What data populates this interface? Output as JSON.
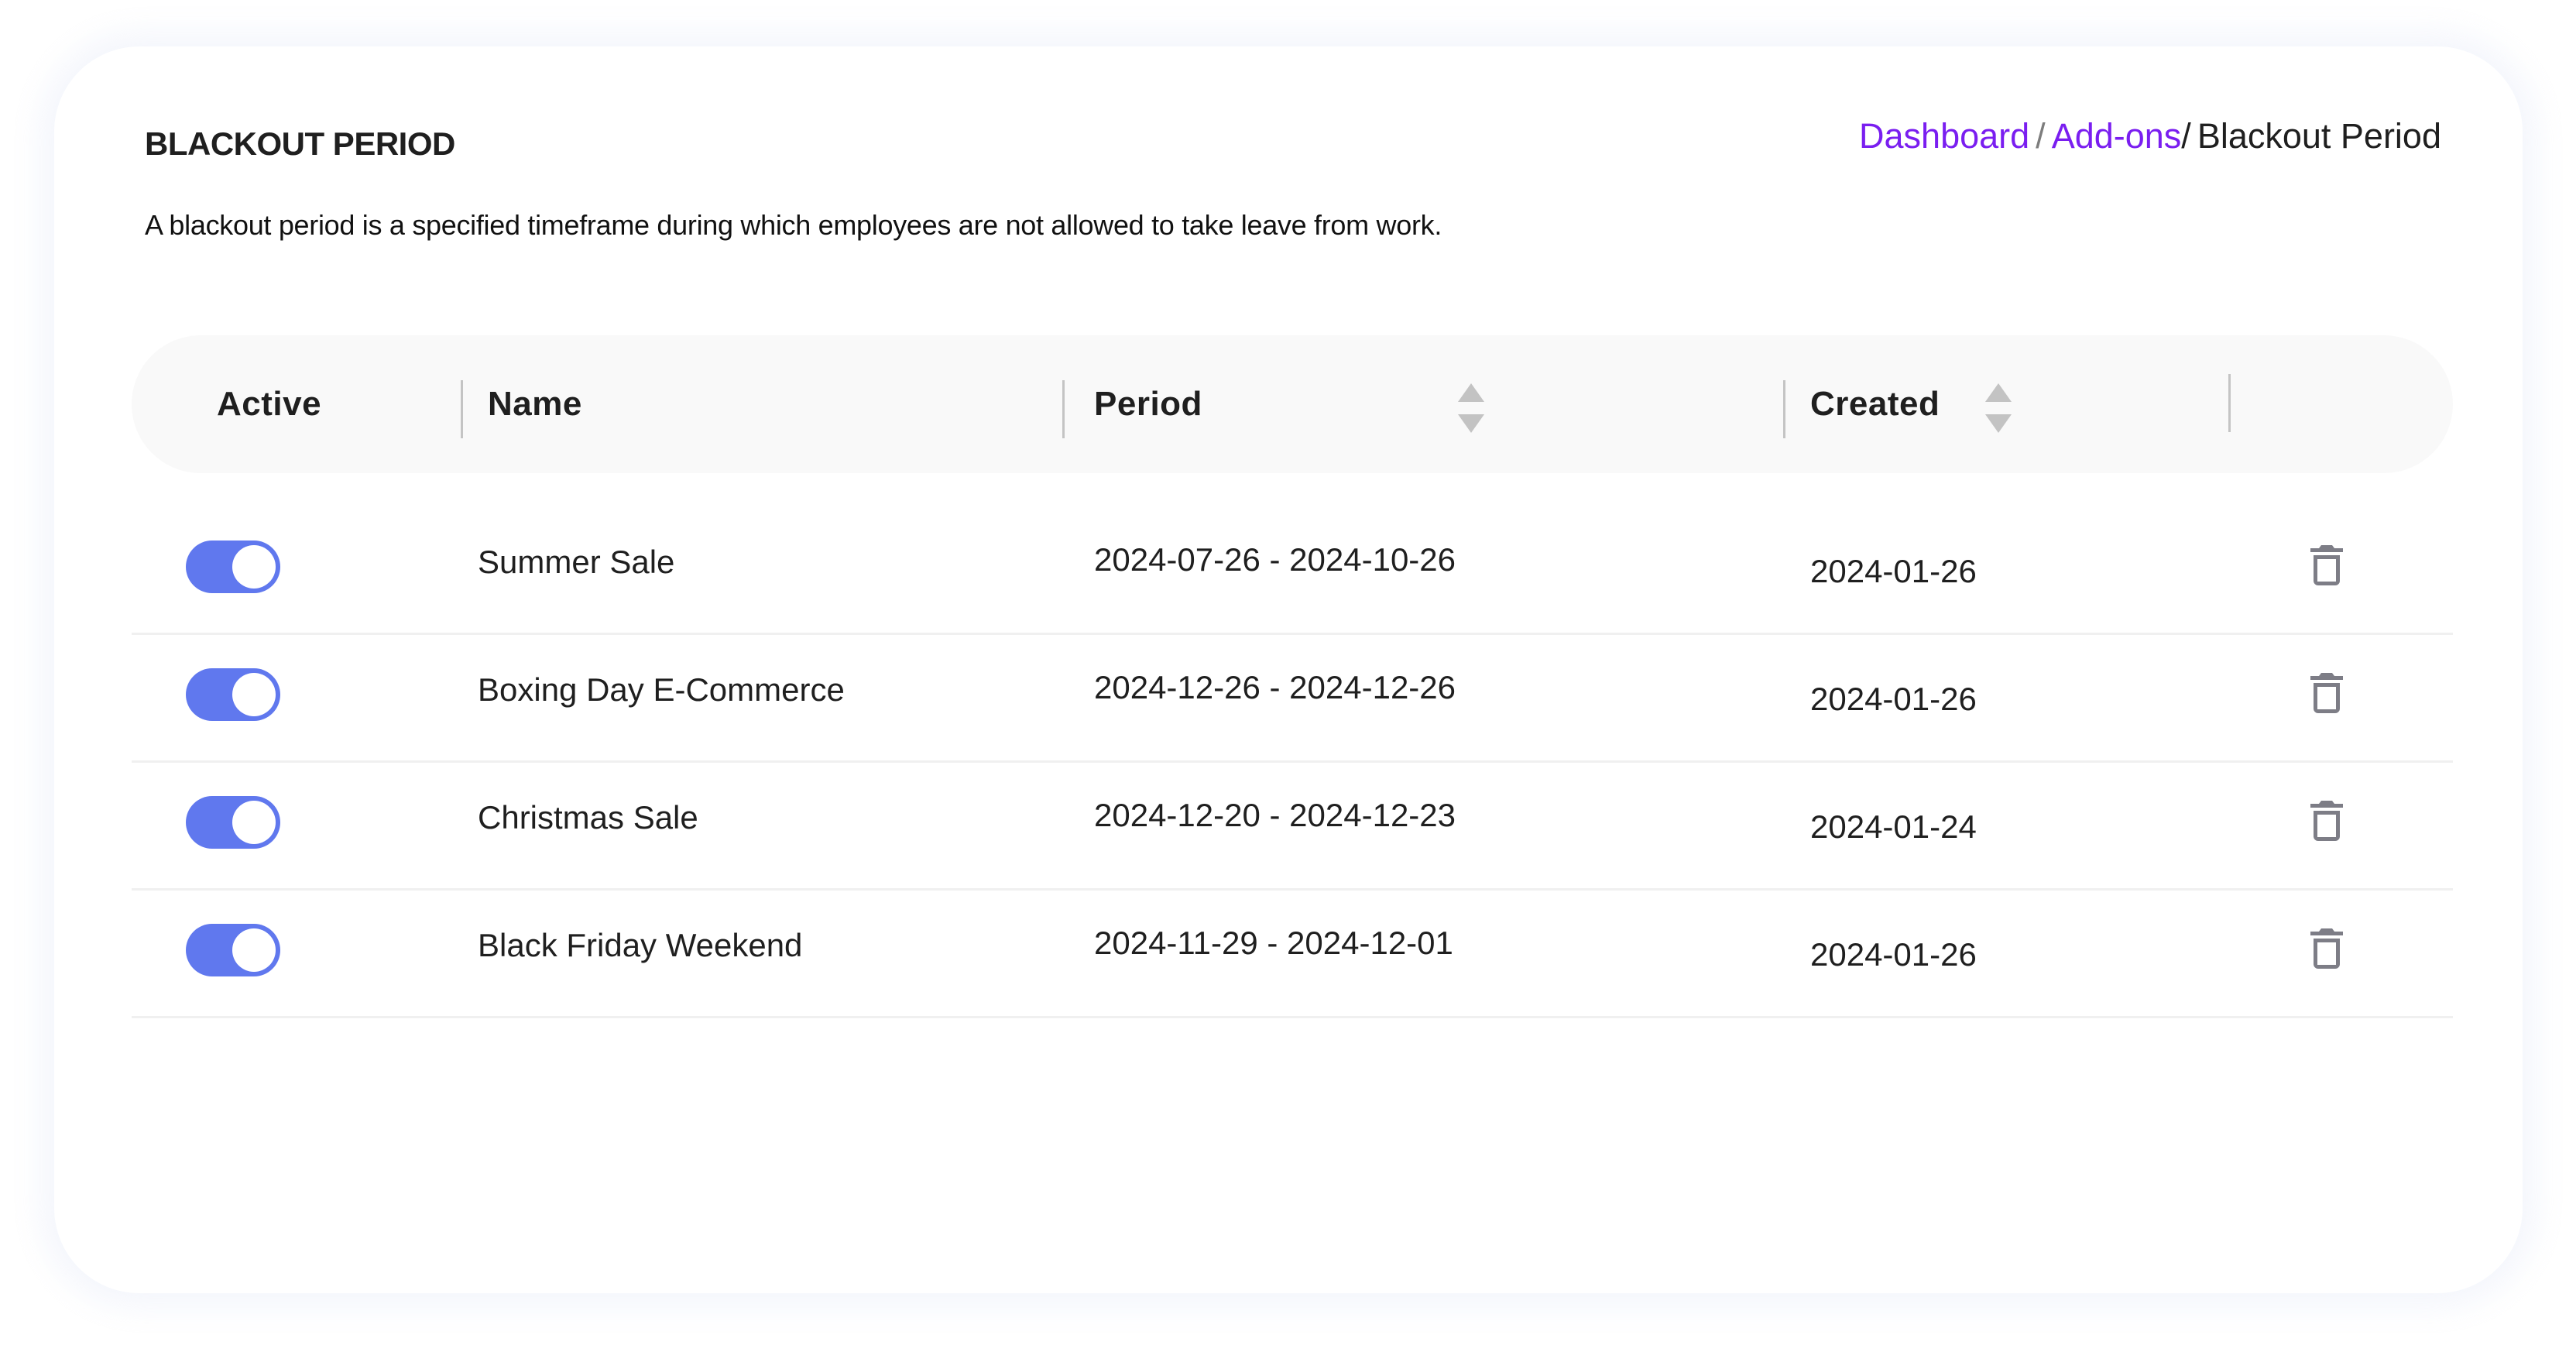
{
  "page": {
    "title": "BLACKOUT PERIOD",
    "description": "A blackout period is a specified timeframe during which employees are not allowed to take leave from work."
  },
  "breadcrumb": {
    "items": [
      {
        "label": "Dashboard",
        "link": true
      },
      {
        "label": "Add-ons",
        "link": true
      },
      {
        "label": "Blackout Period",
        "link": false
      }
    ],
    "separator": "/"
  },
  "colors": {
    "accent": "#7a1ef0",
    "toggle_on": "#6078ee",
    "header_bg": "#f9f9f9",
    "icon_gray": "#7d7d86"
  },
  "table": {
    "columns": [
      {
        "label": "Active",
        "sortable": false
      },
      {
        "label": "Name",
        "sortable": false
      },
      {
        "label": "Period",
        "sortable": true
      },
      {
        "label": "Created",
        "sortable": true
      },
      {
        "label": "",
        "sortable": false
      }
    ],
    "rows": [
      {
        "active": true,
        "name": "Summer Sale",
        "period": "2024-07-26 - 2024-10-26",
        "created": "2024-01-26",
        "action_icon": "trash-icon"
      },
      {
        "active": true,
        "name": "Boxing Day E-Commerce",
        "period": "2024-12-26 - 2024-12-26",
        "created": "2024-01-26",
        "action_icon": "trash-icon"
      },
      {
        "active": true,
        "name": "Christmas Sale",
        "period": "2024-12-20 - 2024-12-23",
        "created": "2024-01-24",
        "action_icon": "trash-icon"
      },
      {
        "active": true,
        "name": "Black Friday Weekend",
        "period": "2024-11-29 - 2024-12-01",
        "created": "2024-01-26",
        "action_icon": "trash-icon"
      }
    ]
  }
}
